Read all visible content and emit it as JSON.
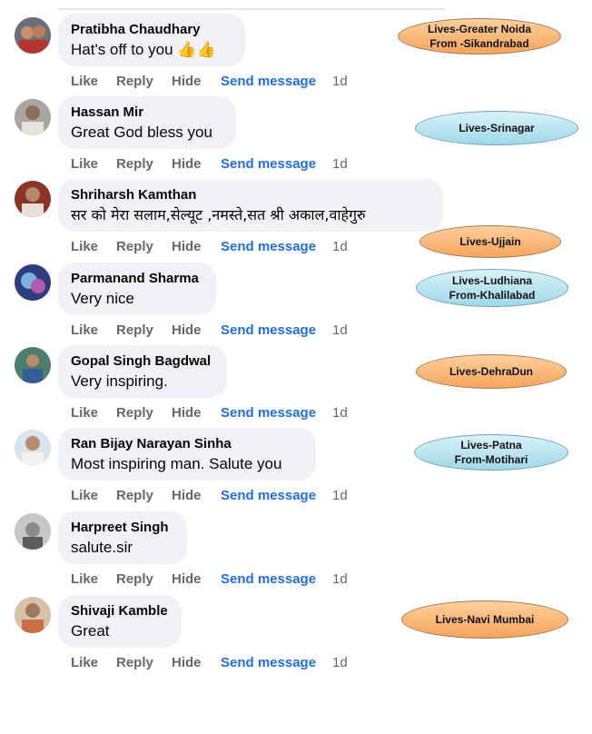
{
  "actions": {
    "like": "Like",
    "reply": "Reply",
    "hide": "Hide",
    "send": "Send message"
  },
  "comments": [
    {
      "author": "Pratibha Chaudhary",
      "text": "Hat's off to you 👍👍",
      "time": "1d",
      "tag": [
        "Lives-Greater Noida",
        "From -Sikandrabad"
      ],
      "tag_color": "orange"
    },
    {
      "author": "Hassan Mir",
      "text": "Great God bless you",
      "time": "1d",
      "tag": [
        "Lives-Srinagar"
      ],
      "tag_color": "blue"
    },
    {
      "author": "Shriharsh Kamthan",
      "text": "सर को मेरा सलाम,सेल्यूट ,नमस्ते,सत श्री अकाल,वाहेगुरु",
      "time": "1d",
      "tag": [
        "Lives-Ujjain"
      ],
      "tag_color": "orange"
    },
    {
      "author": "Parmanand Sharma",
      "text": "Very nice",
      "time": "1d",
      "tag": [
        "Lives-Ludhiana",
        "From-Khalilabad"
      ],
      "tag_color": "blue"
    },
    {
      "author": "Gopal Singh Bagdwal",
      "text": "Very inspiring.",
      "time": "1d",
      "tag": [
        "Lives-DehraDun"
      ],
      "tag_color": "orange"
    },
    {
      "author": "Ran Bijay Narayan Sinha",
      "text": "Most inspiring man. Salute you",
      "time": "1d",
      "tag": [
        "Lives-Patna",
        "From-Motihari"
      ],
      "tag_color": "blue"
    },
    {
      "author": "Harpreet Singh",
      "text": "salute.sir",
      "time": "1d",
      "tag": [],
      "tag_color": ""
    },
    {
      "author": "Shivaji Kamble",
      "text": "Great",
      "time": "1d",
      "tag": [
        "Lives-Navi Mumbai"
      ],
      "tag_color": "orange"
    }
  ]
}
